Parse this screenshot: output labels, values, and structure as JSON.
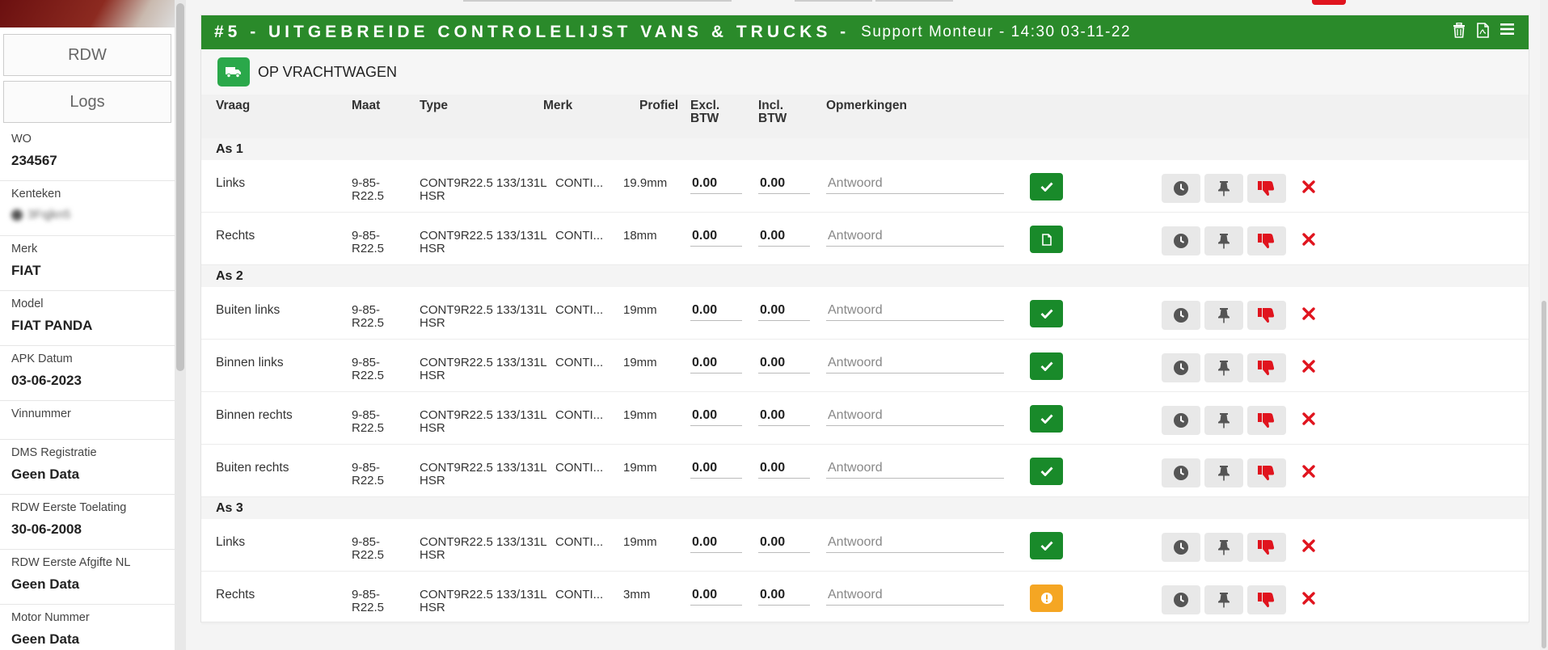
{
  "sidebar": {
    "buttons": {
      "rdw": "RDW",
      "logs": "Logs"
    },
    "info": [
      {
        "label": "WO",
        "value": "234567"
      },
      {
        "label": "Kenteken",
        "value": "3Fqjkn5"
      },
      {
        "label": "Merk",
        "value": "FIAT"
      },
      {
        "label": "Model",
        "value": "FIAT PANDA"
      },
      {
        "label": "APK Datum",
        "value": "03-06-2023"
      },
      {
        "label": "Vinnummer",
        "value": ""
      },
      {
        "label": "DMS Registratie",
        "value": "Geen Data"
      },
      {
        "label": "RDW Eerste Toelating",
        "value": "30-06-2008"
      },
      {
        "label": "RDW Eerste Afgifte NL",
        "value": "Geen Data"
      },
      {
        "label": "Motor Nummer",
        "value": "Geen Data"
      }
    ]
  },
  "header": {
    "title": "#5 - UITGEBREIDE CONTROLELIJST VANS & TRUCKS -",
    "subtitle": "Support Monteur - 14:30 03-11-22",
    "icons": [
      "trash-icon",
      "pdf-icon",
      "menu-icon"
    ]
  },
  "section": {
    "label": "OP VRACHTWAGEN",
    "icon": "truck-icon"
  },
  "columns": {
    "vraag": "Vraag",
    "maat": "Maat",
    "type": "Type",
    "merk": "Merk",
    "profiel": "Profiel",
    "excl1": "Excl.",
    "excl2": "BTW",
    "incl1": "Incl.",
    "incl2": "BTW",
    "opmerkingen": "Opmerkingen"
  },
  "answer_placeholder": "Antwoord",
  "groups": [
    {
      "name": "As 1",
      "rows": [
        {
          "vraag": "Links",
          "maat": "9-85-R22.5",
          "type": "CONT9R22.5 133/131L HSR",
          "merk": "CONTI...",
          "profiel": "19.9mm",
          "excl": "0.00",
          "incl": "0.00",
          "status": "ok"
        },
        {
          "vraag": "Rechts",
          "maat": "9-85-R22.5",
          "type": "CONT9R22.5 133/131L HSR",
          "merk": "CONTI...",
          "profiel": "18mm",
          "excl": "0.00",
          "incl": "0.00",
          "status": "doc"
        }
      ]
    },
    {
      "name": "As 2",
      "rows": [
        {
          "vraag": "Buiten links",
          "maat": "9-85-R22.5",
          "type": "CONT9R22.5 133/131L HSR",
          "merk": "CONTI...",
          "profiel": "19mm",
          "excl": "0.00",
          "incl": "0.00",
          "status": "ok"
        },
        {
          "vraag": "Binnen links",
          "maat": "9-85-R22.5",
          "type": "CONT9R22.5 133/131L HSR",
          "merk": "CONTI...",
          "profiel": "19mm",
          "excl": "0.00",
          "incl": "0.00",
          "status": "ok"
        },
        {
          "vraag": "Binnen rechts",
          "maat": "9-85-R22.5",
          "type": "CONT9R22.5 133/131L HSR",
          "merk": "CONTI...",
          "profiel": "19mm",
          "excl": "0.00",
          "incl": "0.00",
          "status": "ok"
        },
        {
          "vraag": "Buiten rechts",
          "maat": "9-85-R22.5",
          "type": "CONT9R22.5 133/131L HSR",
          "merk": "CONTI...",
          "profiel": "19mm",
          "excl": "0.00",
          "incl": "0.00",
          "status": "ok"
        }
      ]
    },
    {
      "name": "As 3",
      "rows": [
        {
          "vraag": "Links",
          "maat": "9-85-R22.5",
          "type": "CONT9R22.5 133/131L HSR",
          "merk": "CONTI...",
          "profiel": "19mm",
          "excl": "0.00",
          "incl": "0.00",
          "status": "ok"
        },
        {
          "vraag": "Rechts",
          "maat": "9-85-R22.5",
          "type": "CONT9R22.5 133/131L HSR",
          "merk": "CONTI...",
          "profiel": "3mm",
          "excl": "0.00",
          "incl": "0.00",
          "status": "warn"
        }
      ]
    }
  ],
  "colors": {
    "header_green": "#2a8a2a",
    "ok_green": "#198a2a",
    "warn_orange": "#f5a623",
    "reject_red": "#e0141e"
  }
}
